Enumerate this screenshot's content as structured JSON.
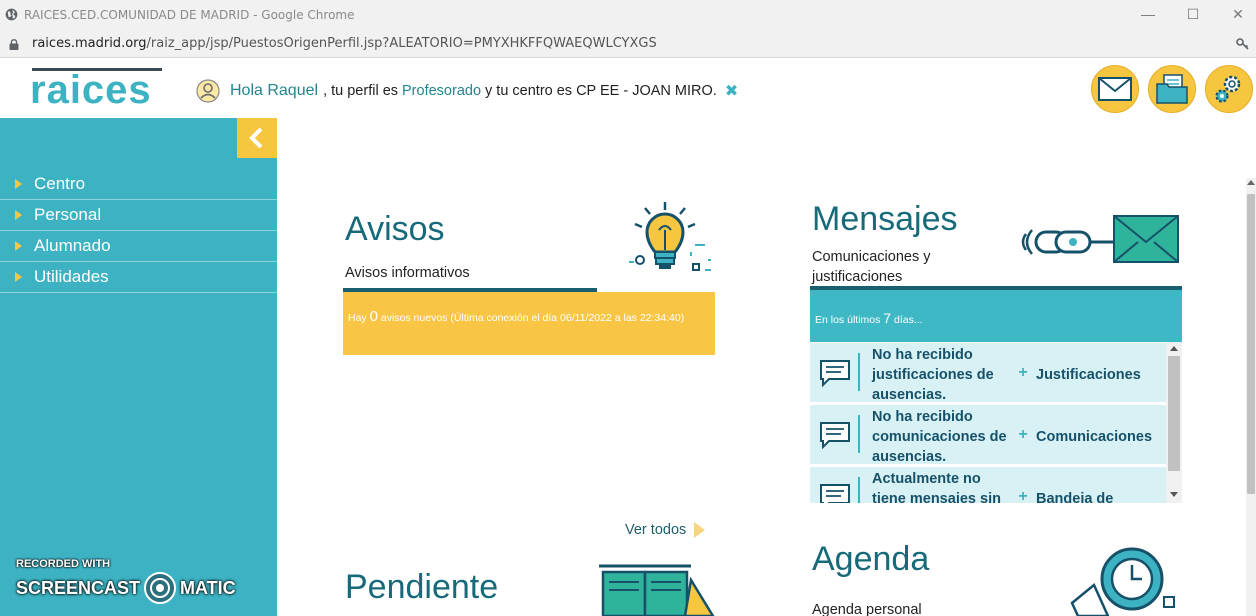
{
  "window": {
    "title": "RAICES.CED.COMUNIDAD DE MADRID - Google Chrome",
    "url_host": "raices.madrid.org",
    "url_path": "/raiz_app/jsp/PuestosOrigenPerfil.jsp?ALEATORIO=PMYXHKFFQWAEQWLCYXGS"
  },
  "header": {
    "logo_text": "raices",
    "greeting": "Hola Raquel",
    "profile_pre": ", tu perfil es",
    "profile": "Profesorado",
    "center_text": "y tu centro es CP EE - JOAN MIRO.",
    "close_glyph": "✖"
  },
  "sidebar": {
    "items": [
      {
        "label": "Centro"
      },
      {
        "label": "Personal"
      },
      {
        "label": "Alumnado"
      },
      {
        "label": "Utilidades"
      }
    ]
  },
  "watermark": {
    "recorded": "RECORDED WITH",
    "left": "SCREENCAST",
    "right": "MATIC"
  },
  "avisos": {
    "title": "Avisos",
    "subtitle": "Avisos informativos",
    "pre": "Hay",
    "count": "0",
    "post": "avisos nuevos (Última conexión el día 06/11/2022 a las 22:34:40)",
    "ver_todos": "Ver todos"
  },
  "mensajes": {
    "title": "Mensajes",
    "subtitle": "Comunicaciones y justificaciones",
    "band_pre": "En los últimos",
    "band_days": "7",
    "band_post": "días...",
    "rows": [
      {
        "text": "No ha recibido justificaciones de ausencias.",
        "action": "Justificaciones"
      },
      {
        "text": "No ha recibido comunicaciones de ausencias.",
        "action": "Comunicaciones"
      },
      {
        "text": "Actualmente no tiene mensajes sin",
        "action": "Bandeja de"
      }
    ]
  },
  "pendiente": {
    "title": "Pendiente"
  },
  "agenda": {
    "title": "Agenda",
    "subtitle": "Agenda personal"
  },
  "colors": {
    "teal": "#3db2c2",
    "yellow": "#f7c641",
    "dark_teal": "#176a79"
  }
}
